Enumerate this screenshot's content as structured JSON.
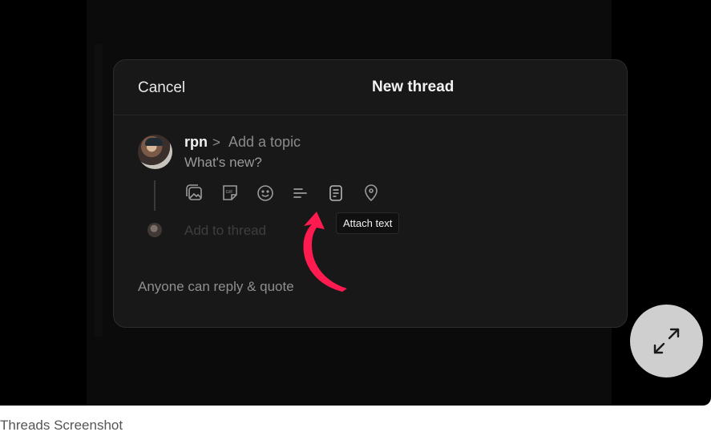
{
  "modal": {
    "cancel_label": "Cancel",
    "title": "New thread",
    "username": "rpn",
    "topic_separator": ">",
    "topic_placeholder": "Add a topic",
    "body_placeholder": "What's new?",
    "add_to_thread": "Add to thread",
    "reply_setting": "Anyone can reply & quote",
    "toolbar_icons": [
      "gallery-icon",
      "gif-icon",
      "emoji-icon",
      "poll-icon",
      "attach-text-icon",
      "location-icon"
    ]
  },
  "tooltip": {
    "text": "Attach text"
  },
  "annotation": {
    "color": "#ff1a4f"
  },
  "expand_button": {
    "icon": "expand-arrows-icon"
  },
  "caption": "Threads Screenshot"
}
